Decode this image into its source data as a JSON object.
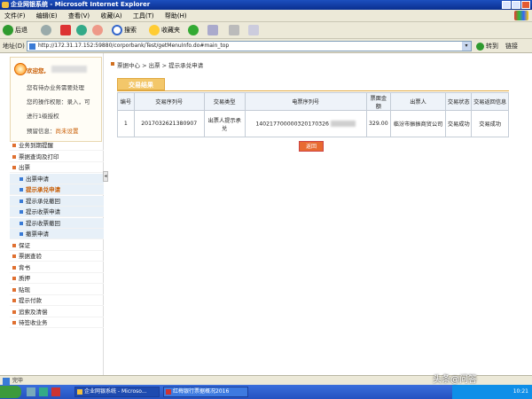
{
  "window": {
    "title": "企业网银系统 - Microsoft Internet Explorer"
  },
  "menubar": {
    "items": [
      "文件(F)",
      "编辑(E)",
      "查看(V)",
      "收藏(A)",
      "工具(T)",
      "帮助(H)"
    ]
  },
  "toolbar": {
    "back_label": "后退",
    "search_label": "搜索",
    "favorites_label": "收藏夹"
  },
  "address": {
    "label": "地址(D)",
    "url": "http://172.31.17.152:59880/corporbank/Test/getMenuInfo.do#main_top",
    "go_label": "转到",
    "links_label": "链接"
  },
  "sidebar": {
    "greeting": "欢迎您,",
    "lines": [
      "您有待办业务需要处理",
      "您的操作权限：录入，可",
      "进行1级授权"
    ],
    "notice_prefix": "预留信息：",
    "notice_value": "尚未设置",
    "items": [
      {
        "label": "业务到期提醒",
        "sub": false,
        "active": false
      },
      {
        "label": "票据查询及打印",
        "sub": false,
        "active": false
      },
      {
        "label": "出票",
        "sub": false,
        "active": false
      },
      {
        "label": "出票申请",
        "sub": true,
        "active": false
      },
      {
        "label": "提示承兑申请",
        "sub": true,
        "active": true
      },
      {
        "label": "提示承兑撤回",
        "sub": true,
        "active": false
      },
      {
        "label": "提示收票申请",
        "sub": true,
        "active": false
      },
      {
        "label": "提示收票撤回",
        "sub": true,
        "active": false
      },
      {
        "label": "撤票申请",
        "sub": true,
        "active": false
      },
      {
        "label": "保证",
        "sub": false,
        "active": false
      },
      {
        "label": "票据查验",
        "sub": false,
        "active": false
      },
      {
        "label": "背书",
        "sub": false,
        "active": false
      },
      {
        "label": "质押",
        "sub": false,
        "active": false
      },
      {
        "label": "贴现",
        "sub": false,
        "active": false
      },
      {
        "label": "提示付款",
        "sub": false,
        "active": false
      },
      {
        "label": "追索及清偿",
        "sub": false,
        "active": false
      },
      {
        "label": "待签收业务",
        "sub": false,
        "active": false
      }
    ]
  },
  "main": {
    "breadcrumb": "票据中心 > 出票 > 提示承兑申请",
    "section_title": "交易结果",
    "table": {
      "headers": [
        "编号",
        "交易序列号",
        "交易类型",
        "电票序列号",
        "票面金额",
        "出票人",
        "交易状态",
        "交易返回信息"
      ],
      "rows": [
        [
          "1",
          "2017032621380907",
          "出票人提示承兑",
          "140217700000320170326",
          "329.00",
          "临汾市振振商贸公司",
          "交易成功",
          "交易成功"
        ]
      ]
    },
    "return_label": "返回"
  },
  "statusbar": {
    "text": "完毕"
  },
  "taskbar": {
    "tasks": [
      "企业网银系统 - Microso...",
      "红梅银行票据概况2016"
    ],
    "time": "10:21"
  },
  "watermark": "头条@问答"
}
